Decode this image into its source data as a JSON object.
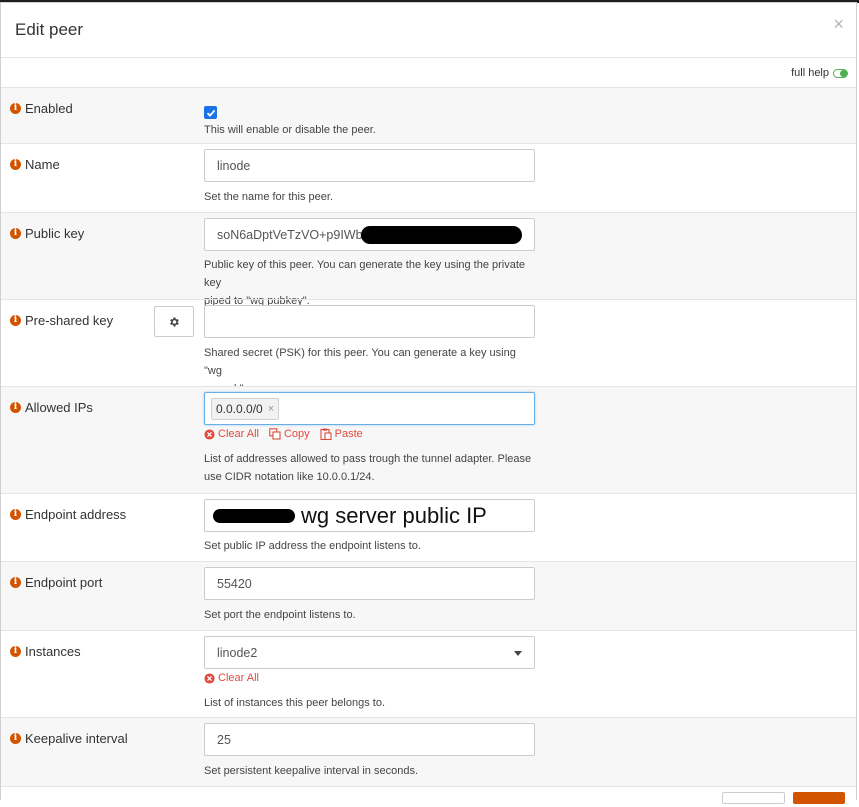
{
  "modal": {
    "title": "Edit peer",
    "close": "×"
  },
  "full_help": {
    "label": "full help"
  },
  "fields": {
    "enabled": {
      "label": "Enabled",
      "checked": true,
      "help": "This will enable or disable the peer."
    },
    "name": {
      "label": "Name",
      "value": "linode",
      "help": "Set the name for this peer."
    },
    "public_key": {
      "label": "Public key",
      "value": "soN6aDptVeTzVO+p9IWb",
      "help1": "Public key of this peer. You can generate the key using the private key",
      "help2": "piped to \"wg pubkey\"."
    },
    "pre_shared_key": {
      "label": "Pre-shared key",
      "value": "",
      "help1": "Shared secret (PSK) for this peer. You can generate a key using \"wg",
      "help2": "genpsk\"."
    },
    "allowed_ips": {
      "label": "Allowed IPs",
      "tags": [
        "0.0.0.0/0"
      ],
      "actions": {
        "clear_all": "Clear All",
        "copy": "Copy",
        "paste": "Paste"
      },
      "help1": "List of addresses allowed to pass trough the tunnel adapter. Please",
      "help2": "use CIDR notation like 10.0.0.1/24."
    },
    "endpoint_address": {
      "label": "Endpoint address",
      "value": "wg server public IP",
      "help": "Set public IP address the endpoint listens to."
    },
    "endpoint_port": {
      "label": "Endpoint port",
      "value": "55420",
      "help": "Set port the endpoint listens to."
    },
    "instances": {
      "label": "Instances",
      "value": "linode2",
      "clear_all": "Clear All",
      "help": "List of instances this peer belongs to."
    },
    "keepalive": {
      "label": "Keepalive interval",
      "value": "25",
      "help": "Set persistent keepalive interval in seconds."
    }
  },
  "colors": {
    "accent": "#d35400",
    "danger": "#e04a3f",
    "focus": "#66afe9",
    "toggle": "#4caf50"
  },
  "icons": {
    "info": "info-icon",
    "gear": "gear-icon",
    "clear": "clear-icon",
    "copy": "copy-icon",
    "paste": "paste-icon",
    "close": "close-icon"
  }
}
